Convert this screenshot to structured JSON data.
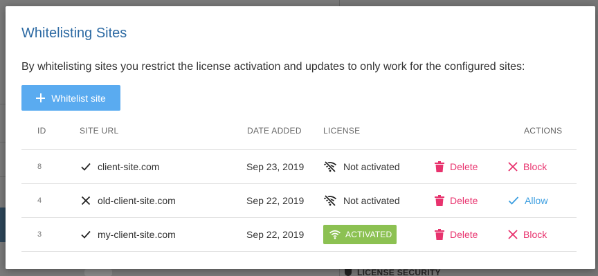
{
  "modal": {
    "title": "Whitelisting Sites",
    "description": "By whitelisting sites you restrict the license activation and updates to only work for the configured sites:",
    "add_button_label": "Whitelist site"
  },
  "table": {
    "headers": {
      "id": "ID",
      "site_url": "SITE URL",
      "date_added": "DATE ADDED",
      "license": "LICENSE",
      "actions": "ACTIONS"
    },
    "rows": [
      {
        "id": "8",
        "status_icon": "check-icon",
        "url": "client-site.com",
        "date": "Sep 23, 2019",
        "license": "Not activated",
        "license_icon": "wifi-off-icon",
        "delete_label": "Delete",
        "action_label": "Block",
        "action_icon": "close-icon"
      },
      {
        "id": "4",
        "status_icon": "close-icon",
        "url": "old-client-site.com",
        "date": "Sep 22, 2019",
        "license": "Not activated",
        "license_icon": "wifi-off-icon",
        "delete_label": "Delete",
        "action_label": "Allow",
        "action_icon": "check-icon"
      },
      {
        "id": "3",
        "status_icon": "check-icon",
        "url": "my-client-site.com",
        "date": "Sep 22, 2019",
        "license": "ACTIVATED",
        "license_icon": "wifi-icon",
        "delete_label": "Delete",
        "action_label": "Block",
        "action_icon": "close-icon"
      }
    ]
  },
  "background": {
    "footer_text": "LICENSE SECURITY"
  },
  "colors": {
    "title": "#2d6aa3",
    "primary_button": "#5aabf0",
    "danger": "#e8336e",
    "link": "#3a9de0",
    "success_badge": "#8cc152"
  }
}
